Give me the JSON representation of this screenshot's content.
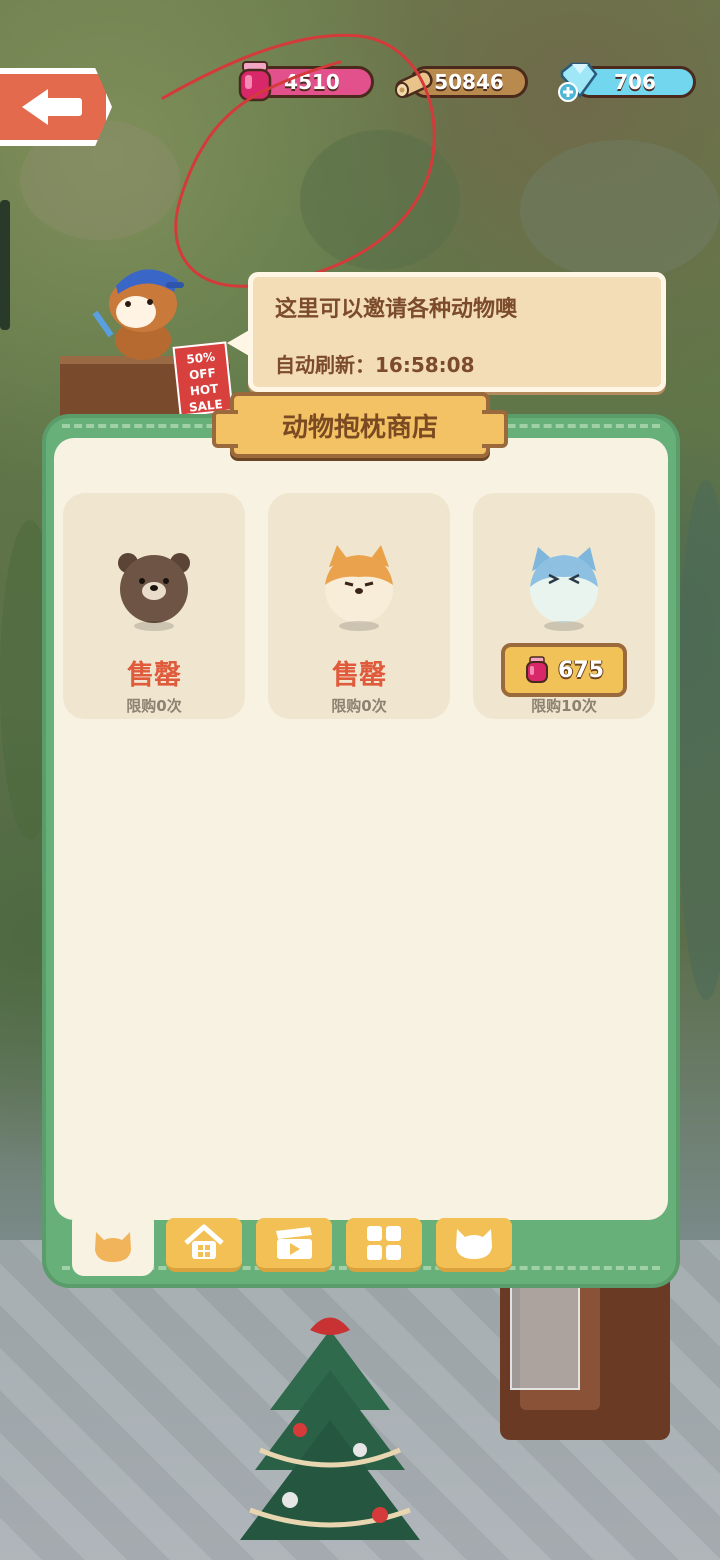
{
  "hud": {
    "jam_count": "4510",
    "wood_count": "50846",
    "gem_count": "706"
  },
  "speech": {
    "line1": "这里可以邀请各种动物噢",
    "refresh_label": "自动刷新：",
    "refresh_time": "16:58:08"
  },
  "shop": {
    "title": "动物抱枕商店",
    "items": [
      {
        "animal": "bear",
        "status": "售罄",
        "limit": "限购0次"
      },
      {
        "animal": "shiba",
        "status": "售罄",
        "limit": "限购0次"
      },
      {
        "animal": "blue-cat",
        "price": "675",
        "limit": "限购10次"
      }
    ]
  },
  "sign": {
    "line1": "50%",
    "line2": "OFF",
    "line3": "HOT",
    "line4": "SALE"
  },
  "tabs": [
    {
      "icon": "cat-face-icon",
      "active": true
    },
    {
      "icon": "house-icon",
      "active": false
    },
    {
      "icon": "clapperboard-icon",
      "active": false
    },
    {
      "icon": "grid-icon",
      "active": false
    },
    {
      "icon": "cat-face-icon",
      "active": false
    }
  ],
  "colors": {
    "panel_green": "#68b07a",
    "cream": "#f8f2e2",
    "soldout_red": "#e05a3c",
    "jam_pink": "#e2518c",
    "wood_tan": "#b98a4e",
    "gem_blue": "#72d7ee"
  }
}
